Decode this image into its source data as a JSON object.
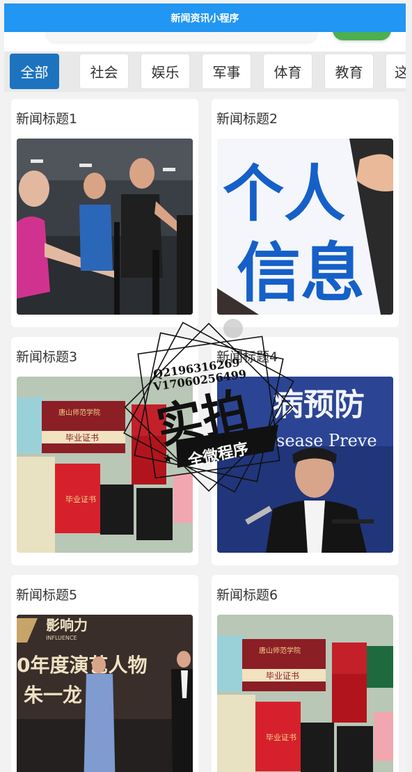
{
  "app": {
    "title": "新闻资讯小程序"
  },
  "tabs": [
    {
      "label": "全部",
      "active": true
    },
    {
      "label": "社会",
      "active": false
    },
    {
      "label": "娱乐",
      "active": false
    },
    {
      "label": "军事",
      "active": false
    },
    {
      "label": "体育",
      "active": false
    },
    {
      "label": "教育",
      "active": false
    },
    {
      "label": "这",
      "active": false
    }
  ],
  "news": [
    {
      "title": "新闻标题1",
      "image": "fitness-gym-photo"
    },
    {
      "title": "新闻标题2",
      "image": "personal-info-sign-photo"
    },
    {
      "title": "新闻标题3",
      "image": "diplomas-photo"
    },
    {
      "title": "新闻标题4",
      "image": "press-conference-photo"
    },
    {
      "title": "新闻标题5",
      "image": "award-stage-photo"
    },
    {
      "title": "新闻标题6",
      "image": "diplomas-photo"
    }
  ],
  "images": {
    "personal_info_text_1": "个人",
    "personal_info_text_2": "信息",
    "diploma_school": "唐山师范学院",
    "diploma_title": "毕业证书",
    "diploma_red_title": "毕业证书",
    "press_banner_1": "病预防",
    "press_banner_2": "sease Preve",
    "stage_logo": "影响力",
    "stage_logo_sub": "INFLUENCE",
    "stage_text_1": "0年度演艺人物",
    "stage_text_2": "朱一龙"
  },
  "watermark": {
    "line1": "Q2196316269",
    "line2": "V17060256499",
    "big": "实拍",
    "ribbon": "全微程序"
  },
  "colors": {
    "title_bar": "#2196f3",
    "tab_active": "#1e73be",
    "accent_green": "#4caf50"
  }
}
